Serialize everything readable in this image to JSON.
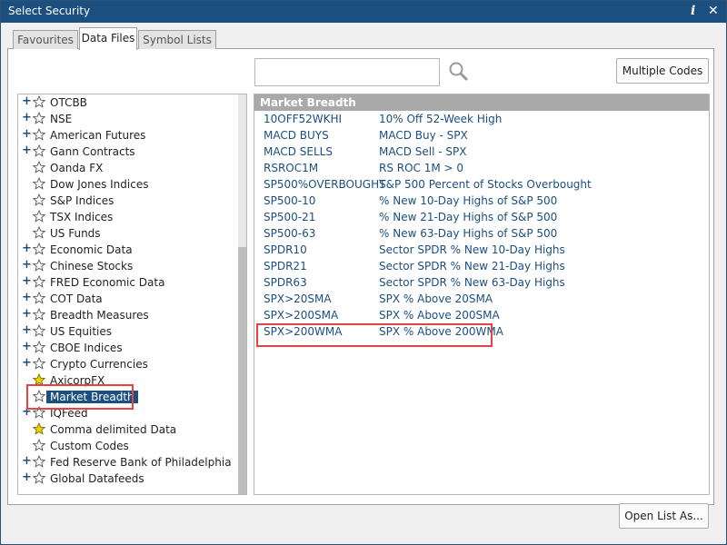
{
  "window": {
    "title": "Select Security",
    "info_glyph": "i",
    "close_glyph": "✕"
  },
  "tabs": [
    {
      "label": "Favourites"
    },
    {
      "label": "Data Files"
    },
    {
      "label": "Symbol Lists"
    }
  ],
  "search": {
    "value": "",
    "placeholder": ""
  },
  "buttons": {
    "multiple_codes": "Multiple Codes",
    "open_list_as": "Open List As..."
  },
  "tree": {
    "items": [
      {
        "label": "OTCBB",
        "expandable": true,
        "star": "empty"
      },
      {
        "label": "NSE",
        "expandable": true,
        "star": "empty"
      },
      {
        "label": "American Futures",
        "expandable": true,
        "star": "empty"
      },
      {
        "label": "Gann Contracts",
        "expandable": true,
        "star": "empty"
      },
      {
        "label": "Oanda FX",
        "expandable": false,
        "star": "empty"
      },
      {
        "label": "Dow Jones Indices",
        "expandable": false,
        "star": "empty"
      },
      {
        "label": "S&P Indices",
        "expandable": false,
        "star": "empty"
      },
      {
        "label": "TSX Indices",
        "expandable": false,
        "star": "empty"
      },
      {
        "label": "US Funds",
        "expandable": false,
        "star": "empty"
      },
      {
        "label": "Economic Data",
        "expandable": true,
        "star": "empty"
      },
      {
        "label": "Chinese Stocks",
        "expandable": true,
        "star": "empty"
      },
      {
        "label": "FRED Economic Data",
        "expandable": true,
        "star": "empty"
      },
      {
        "label": "COT Data",
        "expandable": true,
        "star": "empty"
      },
      {
        "label": "Breadth Measures",
        "expandable": true,
        "star": "empty"
      },
      {
        "label": "US Equities",
        "expandable": true,
        "star": "empty"
      },
      {
        "label": "CBOE Indices",
        "expandable": true,
        "star": "empty"
      },
      {
        "label": "Crypto Currencies",
        "expandable": true,
        "star": "empty"
      },
      {
        "label": "AxicorpFX",
        "expandable": false,
        "star": "gold"
      },
      {
        "label": "Market Breadth",
        "expandable": false,
        "star": "empty",
        "selected": true
      },
      {
        "label": "IQFeed",
        "expandable": true,
        "star": "empty"
      },
      {
        "label": "Comma delimited Data",
        "expandable": false,
        "star": "gold"
      },
      {
        "label": "Custom Codes",
        "expandable": false,
        "star": "empty"
      },
      {
        "label": "Fed Reserve Bank of Philadelphia",
        "expandable": true,
        "star": "empty"
      },
      {
        "label": "Global Datafeeds",
        "expandable": true,
        "star": "empty"
      }
    ]
  },
  "list": {
    "header": "Market Breadth",
    "rows": [
      {
        "code": "10OFF52WKHI",
        "desc": "10% Off 52-Week High"
      },
      {
        "code": "MACD BUYS",
        "desc": "MACD Buy - SPX"
      },
      {
        "code": "MACD SELLS",
        "desc": "MACD Sell - SPX"
      },
      {
        "code": "RSROC1M",
        "desc": "RS ROC 1M > 0"
      },
      {
        "code": "SP500%OVERBOUGHT",
        "desc": "S&P 500 Percent of Stocks Overbought"
      },
      {
        "code": "SP500-10",
        "desc": "% New 10-Day Highs of S&P 500"
      },
      {
        "code": "SP500-21",
        "desc": "% New 21-Day Highs of S&P 500"
      },
      {
        "code": "SP500-63",
        "desc": "% New 63-Day Highs of S&P 500"
      },
      {
        "code": "SPDR10",
        "desc": "Sector SPDR % New 10-Day Highs"
      },
      {
        "code": "SPDR21",
        "desc": "Sector SPDR % New 21-Day Highs"
      },
      {
        "code": "SPDR63",
        "desc": "Sector SPDR % New 63-Day Highs"
      },
      {
        "code": "SPX>20SMA",
        "desc": "SPX % Above 20SMA"
      },
      {
        "code": "SPX>200SMA",
        "desc": "SPX % Above 200SMA"
      },
      {
        "code": "SPX>200WMA",
        "desc": "SPX % Above 200WMA"
      }
    ]
  },
  "colors": {
    "accent": "#1b4f80",
    "highlight": "#e04444",
    "star_gold": "#f5d000"
  }
}
